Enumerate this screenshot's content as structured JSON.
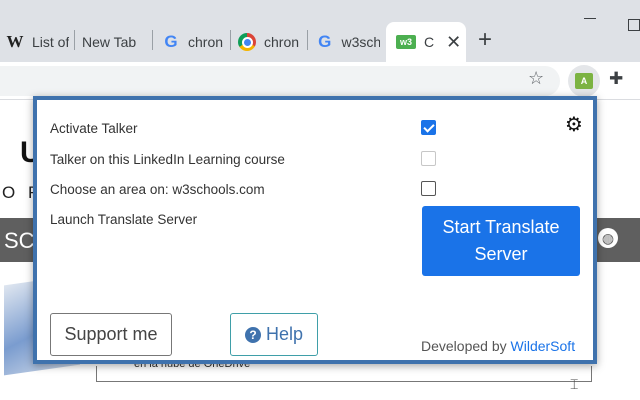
{
  "browser": {
    "tabs": [
      {
        "label": "List of",
        "favicon": "wikipedia-icon",
        "active": false
      },
      {
        "label": "New Tab",
        "favicon": "",
        "active": false
      },
      {
        "label": "chron",
        "favicon": "google-icon",
        "active": false
      },
      {
        "label": "chron",
        "favicon": "chrome-icon",
        "active": false
      },
      {
        "label": "w3sch",
        "favicon": "google-icon",
        "active": false
      },
      {
        "label": "C",
        "favicon": "w3schools-icon",
        "active": true
      }
    ],
    "new_tab_symbol": "+",
    "extension_badge": "A"
  },
  "background_page": {
    "heading_fragment": "U",
    "subheading_fragment": "O R E",
    "nav_fragment": "SC",
    "caption": "en la nube de OneDrive"
  },
  "popup": {
    "options": [
      {
        "label": "Activate Talker",
        "checked": true,
        "disabled": false
      },
      {
        "label": "Talker on this LinkedIn Learning course",
        "checked": false,
        "disabled": true
      },
      {
        "label": "Choose an area on: w3schools.com",
        "checked": false,
        "disabled": false
      },
      {
        "label": "Launch Translate Server"
      }
    ],
    "start_button_line1": "Start Translate",
    "start_button_line2": "Server",
    "support_button": "Support me",
    "help_button": "Help",
    "developed_by_prefix": "Developed by",
    "developer_link": "WilderSoft",
    "colors": {
      "accent": "#1a73e8",
      "border": "#3f72ad"
    }
  }
}
